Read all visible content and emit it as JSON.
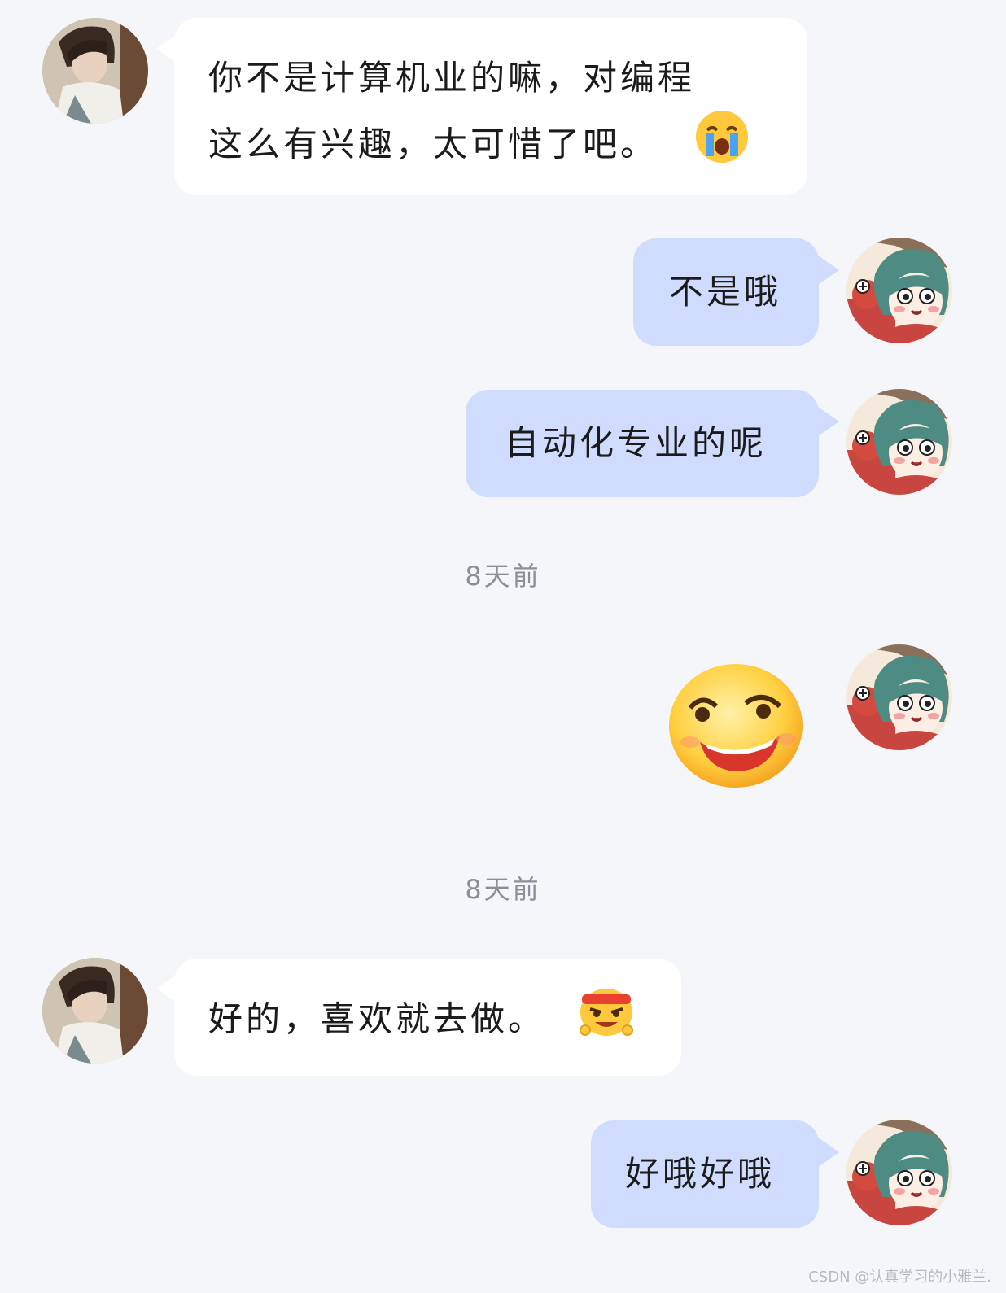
{
  "messages": [
    {
      "side": "in",
      "text_line1": "你不是计算机业的嘛，对编程",
      "text_line2": "这么有兴趣，太可惜了吧。",
      "emoji": "crying-face"
    },
    {
      "side": "out",
      "text": "不是哦"
    },
    {
      "side": "out",
      "text": "自动化专业的呢"
    },
    {
      "side": "out",
      "sticker": "grinning-smirk-sticker"
    },
    {
      "side": "in",
      "text": "好的，喜欢就去做。",
      "emoji": "determined-headband-face"
    },
    {
      "side": "out",
      "text": "好哦好哦"
    }
  ],
  "timestamps": [
    "8天前",
    "8天前"
  ],
  "watermark": "CSDN @认真学习的小雅兰.",
  "colors": {
    "background": "#f5f6fa",
    "incoming_bubble": "#ffffff",
    "outgoing_bubble": "#cfdcfd",
    "timestamp": "#8b8f98"
  }
}
